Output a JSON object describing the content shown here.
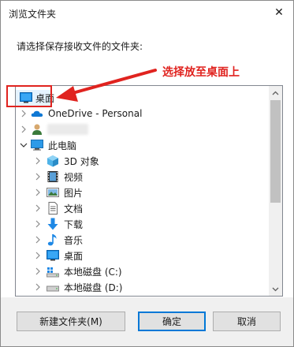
{
  "window": {
    "title": "浏览文件夹",
    "close_glyph": "✕"
  },
  "instruction": "请选择保存接收文件的文件夹:",
  "annotation": {
    "text": "选择放至桌面上",
    "color": "#e0231f"
  },
  "tree": {
    "items": [
      {
        "label": "桌面",
        "icon": "desktop-icon",
        "expander": "none",
        "selected": true
      },
      {
        "label": "OneDrive - Personal",
        "icon": "onedrive-cloud-icon",
        "expander": "collapsed"
      },
      {
        "label": "",
        "icon": "user-icon",
        "expander": "collapsed"
      },
      {
        "label": "此电脑",
        "icon": "this-pc-icon",
        "expander": "expanded"
      },
      {
        "label": "3D 对象",
        "icon": "3d-objects-icon",
        "expander": "collapsed"
      },
      {
        "label": "视频",
        "icon": "videos-icon",
        "expander": "collapsed"
      },
      {
        "label": "图片",
        "icon": "pictures-icon",
        "expander": "collapsed"
      },
      {
        "label": "文档",
        "icon": "documents-icon",
        "expander": "collapsed"
      },
      {
        "label": "下载",
        "icon": "downloads-icon",
        "expander": "collapsed"
      },
      {
        "label": "音乐",
        "icon": "music-icon",
        "expander": "collapsed"
      },
      {
        "label": "桌面",
        "icon": "desktop-icon",
        "expander": "collapsed"
      },
      {
        "label": "本地磁盘 (C:)",
        "icon": "windows-drive-icon",
        "expander": "collapsed"
      },
      {
        "label": "本地磁盘 (D:)",
        "icon": "drive-icon",
        "expander": "collapsed"
      }
    ]
  },
  "buttons": {
    "new_folder": "新建文件夹(M)",
    "ok": "确定",
    "cancel": "取消"
  },
  "colors": {
    "accent": "#0078d7",
    "selection": "#e5f3ff",
    "annotation_red": "#e0231f"
  }
}
